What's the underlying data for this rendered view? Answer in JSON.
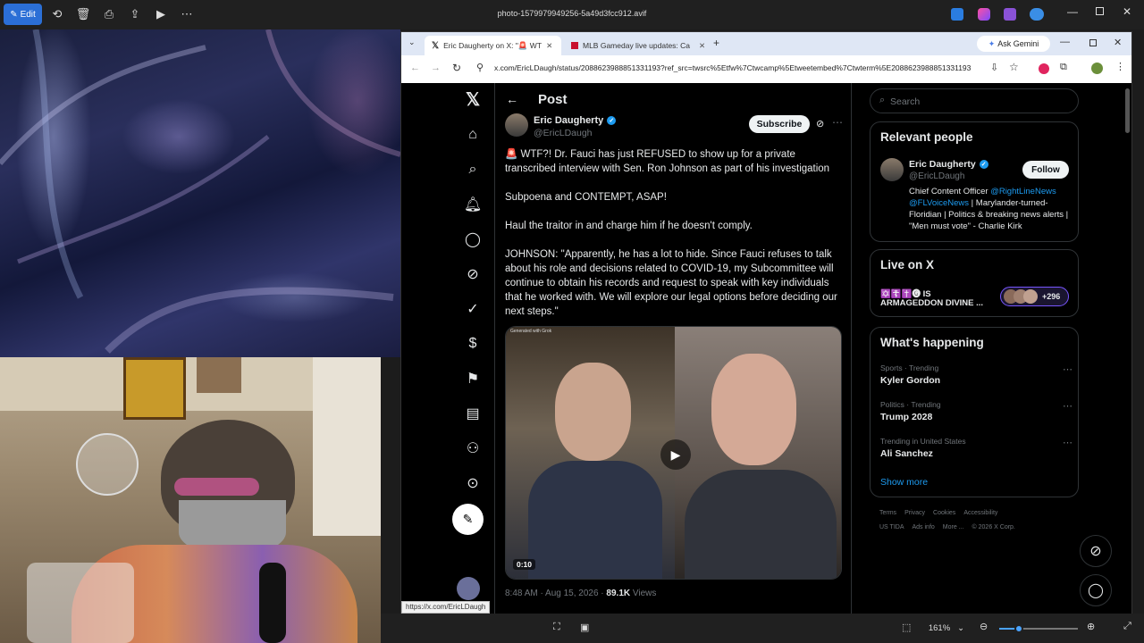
{
  "viewer": {
    "edit_label": "Edit",
    "filename": "photo-1579979949256-5a49d3fcc912.avif",
    "zoom": "161%"
  },
  "browser": {
    "tabs": [
      {
        "label": "Eric Daugherty on X: \"🚨 WTF?!"
      },
      {
        "label": "MLB Gameday live updates: Ca"
      }
    ],
    "ask_gemini": "Ask Gemini",
    "url": "x.com/EricLDaugh/status/2088623988851331193?ref_src=twsrc%5Etfw%7Ctwcamp%5Etweetembed%7Ctwterm%5E2088623988851331193"
  },
  "post": {
    "header_title": "Post",
    "author_name": "Eric Daugherty",
    "author_handle": "@EricLDaugh",
    "subscribe_label": "Subscribe",
    "paragraphs": [
      "🚨 WTF?! Dr. Fauci has just REFUSED to show up for a private transcribed interview with Sen. Ron Johnson as part of his investigation",
      "Subpoena and CONTEMPT, ASAP!",
      "Haul the traitor in and charge him if he doesn't comply.",
      "JOHNSON: \"Apparently, he has a lot to hide. Since Fauci refuses to talk about his role and decisions related to COVID-19, my Subcommittee will continue to obtain his records and request to speak with key individuals that he worked with. We will explore our legal options before deciding our next steps.\""
    ],
    "video_duration": "0:10",
    "video_badge": "Generated with Grok",
    "timestamp": "8:48 AM · Aug 15, 2026 · ",
    "views_count": "89.1K",
    "views_label": " Views"
  },
  "status_url": "https://x.com/EricLDaugh",
  "right": {
    "search_placeholder": "Search",
    "relevant_title": "Relevant people",
    "person_name": "Eric Daugherty",
    "person_handle": "@EricLDaugh",
    "follow_label": "Follow",
    "bio_prefix": "Chief Content Officer ",
    "bio_link1": "@RightLineNews",
    "bio_link2": "@FLVoiceNews",
    "bio_rest": " | Marylander-turned-Floridian | Politics & breaking news alerts | \"Men must vote\" - Charlie Kirk",
    "live_title": "Live on X",
    "live_line1": "✡️☦️✝️🅖 IS",
    "live_line2": "ARMAGEDDON DIVINE ...",
    "live_count": "+296",
    "happening_title": "What's happening",
    "trends": [
      {
        "context": "Sports · Trending",
        "name": "Kyler Gordon"
      },
      {
        "context": "Politics · Trending",
        "name": "Trump 2028"
      },
      {
        "context": "Trending in United States",
        "name": "Ali Sanchez"
      }
    ],
    "show_more": "Show more",
    "footer_line1": [
      "Terms",
      "Privacy",
      "Cookies",
      "Accessibility"
    ],
    "footer_line2": [
      "US TIDA",
      "Ads info",
      "More ...",
      "© 2026 X Corp."
    ]
  },
  "colors": {
    "accent_blue": "#1d9bf0",
    "viewer_edit": "#2b6fd6"
  }
}
